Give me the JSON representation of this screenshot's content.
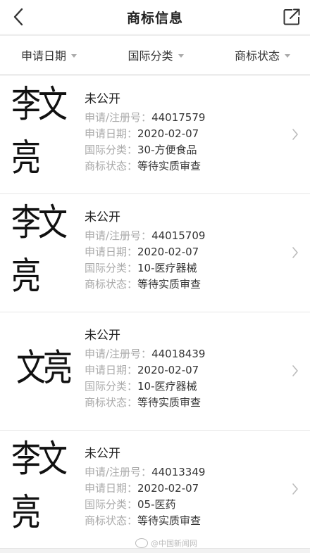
{
  "header": {
    "title": "商标信息"
  },
  "filters": [
    {
      "label": "申请日期"
    },
    {
      "label": "国际分类"
    },
    {
      "label": "商标状态"
    }
  ],
  "labels": {
    "reg_no": "申请/注册号：",
    "date": "申请日期：",
    "class": "国际分类：",
    "status": "商标状态："
  },
  "trademarks": [
    {
      "mark": "李文亮",
      "name": "未公开",
      "reg_no": "44017579",
      "date": "2020-02-07",
      "class": "30-方便食品",
      "status": "等待实质审查"
    },
    {
      "mark": "李文亮",
      "name": "未公开",
      "reg_no": "44015709",
      "date": "2020-02-07",
      "class": "10-医疗器械",
      "status": "等待实质审查"
    },
    {
      "mark": "文亮",
      "name": "未公开",
      "reg_no": "44018439",
      "date": "2020-02-07",
      "class": "10-医疗器械",
      "status": "等待实质审查"
    },
    {
      "mark": "李文亮",
      "name": "未公开",
      "reg_no": "44013349",
      "date": "2020-02-07",
      "class": "05-医药",
      "status": "等待实质审查"
    }
  ],
  "watermark": "@中国新闻网",
  "icons": {
    "back": "back-arrow-icon",
    "share": "share-icon",
    "chevron": "chevron-right-icon"
  }
}
